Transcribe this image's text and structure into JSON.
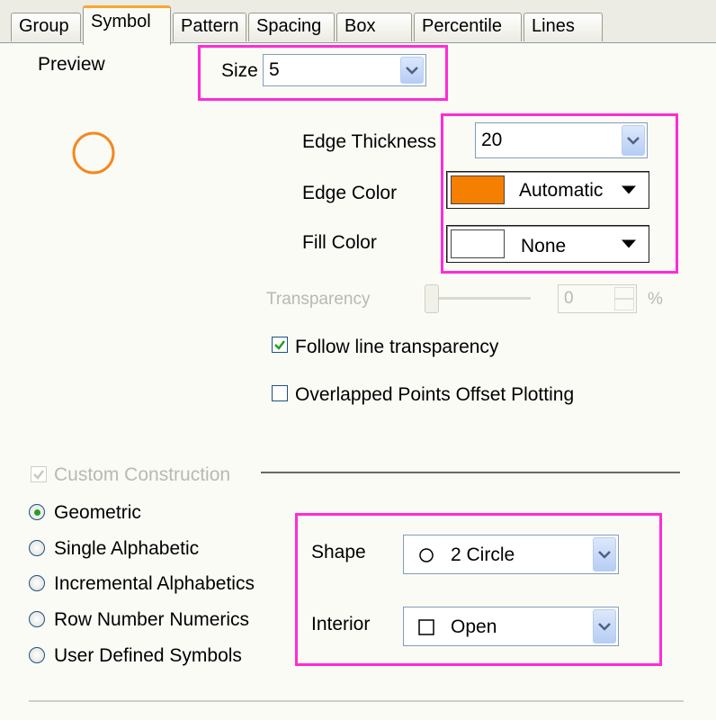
{
  "tabs": [
    {
      "label": "Group"
    },
    {
      "label": "Symbol"
    },
    {
      "label": "Pattern"
    },
    {
      "label": "Spacing"
    },
    {
      "label": "Box"
    },
    {
      "label": "Percentile"
    },
    {
      "label": "Lines"
    }
  ],
  "preview": {
    "label": "Preview",
    "symbol_color": "#f5871f"
  },
  "size": {
    "label": "Size",
    "value": "5"
  },
  "edge_thickness": {
    "label": "Edge Thickness",
    "value": "20"
  },
  "edge_color": {
    "label": "Edge Color",
    "value": "Automatic",
    "swatch": "#f57f00"
  },
  "fill_color": {
    "label": "Fill Color",
    "value": "None",
    "swatch": "#ffffff"
  },
  "transparency": {
    "label": "Transparency",
    "value": "0",
    "unit": "%"
  },
  "follow_line_transparency": {
    "label": "Follow line transparency",
    "checked": true
  },
  "overlapped_points": {
    "label": "Overlapped Points Offset Plotting",
    "checked": false
  },
  "custom_construction": {
    "label": "Custom Construction",
    "checked": true
  },
  "construction_options": [
    {
      "label": "Geometric",
      "selected": true
    },
    {
      "label": "Single Alphabetic",
      "selected": false
    },
    {
      "label": "Incremental Alphabetics",
      "selected": false
    },
    {
      "label": "Row Number Numerics",
      "selected": false
    },
    {
      "label": "User Defined Symbols",
      "selected": false
    }
  ],
  "shape": {
    "label": "Shape",
    "value": "2 Circle"
  },
  "interior": {
    "label": "Interior",
    "value": "Open"
  },
  "highlight_color": "#ff2bd6"
}
